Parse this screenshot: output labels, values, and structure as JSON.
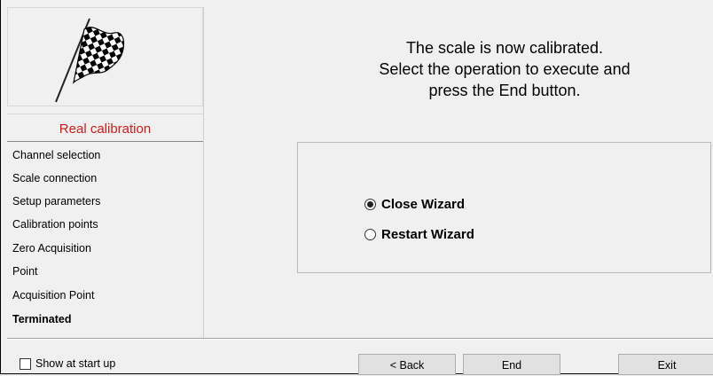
{
  "sidebar": {
    "title": "Real calibration",
    "steps": [
      {
        "label": "Channel selection"
      },
      {
        "label": "Scale connection"
      },
      {
        "label": "Setup parameters"
      },
      {
        "label": "Calibration points"
      },
      {
        "label": "Zero Acquisition"
      },
      {
        "label": "Point"
      },
      {
        "label": "Acquisition Point"
      },
      {
        "label": "Terminated",
        "current": true
      }
    ]
  },
  "main": {
    "message_line1": "The scale is now calibrated.",
    "message_line2": "Select the operation to execute and",
    "message_line3": "press the End button.",
    "options": [
      {
        "label": "Close Wizard",
        "selected": true
      },
      {
        "label": "Restart Wizard",
        "selected": false
      }
    ]
  },
  "footer": {
    "show_at_startup_label": "Show at start up",
    "show_at_startup_checked": false,
    "back_label": "< Back",
    "end_label": "End",
    "exit_label": "Exit"
  },
  "icons": {
    "logo": "checkered-flag-icon"
  },
  "colors": {
    "sidebar_title": "#d21a1a",
    "background": "#f0f0f0"
  }
}
